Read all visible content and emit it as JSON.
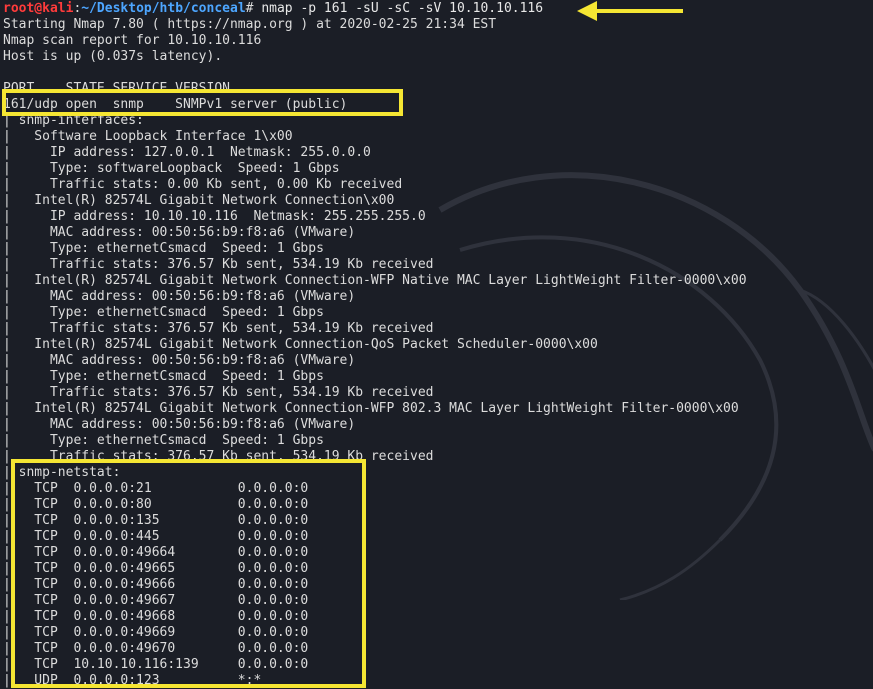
{
  "prompt": {
    "user": "root@kali",
    "separator": ":",
    "path": "~/Desktop/htb/conceal",
    "symbol": "# ",
    "command": "nmap -p 161 -sU -sC -sV 10.10.10.116"
  },
  "lines": [
    "Starting Nmap 7.80 ( https://nmap.org ) at 2020-02-25 21:34 EST",
    "Nmap scan report for 10.10.10.116",
    "Host is up (0.037s latency).",
    "",
    "PORT    STATE SERVICE VERSION",
    "161/udp open  snmp    SNMPv1 server (public)",
    "| snmp-interfaces:",
    "|   Software Loopback Interface 1\\x00",
    "|     IP address: 127.0.0.1  Netmask: 255.0.0.0",
    "|     Type: softwareLoopback  Speed: 1 Gbps",
    "|     Traffic stats: 0.00 Kb sent, 0.00 Kb received",
    "|   Intel(R) 82574L Gigabit Network Connection\\x00",
    "|     IP address: 10.10.10.116  Netmask: 255.255.255.0",
    "|     MAC address: 00:50:56:b9:f8:a6 (VMware)",
    "|     Type: ethernetCsmacd  Speed: 1 Gbps",
    "|     Traffic stats: 376.57 Kb sent, 534.19 Kb received",
    "|   Intel(R) 82574L Gigabit Network Connection-WFP Native MAC Layer LightWeight Filter-0000\\x00",
    "|     MAC address: 00:50:56:b9:f8:a6 (VMware)",
    "|     Type: ethernetCsmacd  Speed: 1 Gbps",
    "|     Traffic stats: 376.57 Kb sent, 534.19 Kb received",
    "|   Intel(R) 82574L Gigabit Network Connection-QoS Packet Scheduler-0000\\x00",
    "|     MAC address: 00:50:56:b9:f8:a6 (VMware)",
    "|     Type: ethernetCsmacd  Speed: 1 Gbps",
    "|     Traffic stats: 376.57 Kb sent, 534.19 Kb received",
    "|   Intel(R) 82574L Gigabit Network Connection-WFP 802.3 MAC Layer LightWeight Filter-0000\\x00",
    "|     MAC address: 00:50:56:b9:f8:a6 (VMware)",
    "|     Type: ethernetCsmacd  Speed: 1 Gbps",
    "|     Traffic stats: 376.57 Kb sent, 534.19 Kb received",
    "| snmp-netstat:",
    "|   TCP  0.0.0.0:21           0.0.0.0:0",
    "|   TCP  0.0.0.0:80           0.0.0.0:0",
    "|   TCP  0.0.0.0:135          0.0.0.0:0",
    "|   TCP  0.0.0.0:445          0.0.0.0:0",
    "|   TCP  0.0.0.0:49664        0.0.0.0:0",
    "|   TCP  0.0.0.0:49665        0.0.0.0:0",
    "|   TCP  0.0.0.0:49666        0.0.0.0:0",
    "|   TCP  0.0.0.0:49667        0.0.0.0:0",
    "|   TCP  0.0.0.0:49668        0.0.0.0:0",
    "|   TCP  0.0.0.0:49669        0.0.0.0:0",
    "|   TCP  0.0.0.0:49670        0.0.0.0:0",
    "|   TCP  10.10.10.116:139     0.0.0.0:0",
    "|   UDP  0.0.0.0:123          *:*"
  ],
  "colors": {
    "background": "#1b1e26",
    "text": "#dcdcdc",
    "prompt_user": "#ff3b3b",
    "prompt_path": "#4da6ff",
    "highlight": "#f5e633"
  },
  "icons": [
    "arrow-left-icon",
    "kali-dragon-watermark-icon"
  ]
}
